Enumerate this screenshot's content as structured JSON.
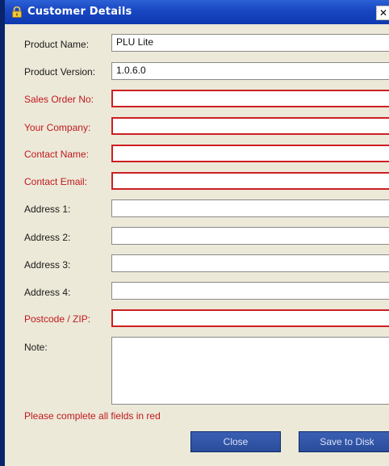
{
  "window": {
    "title": "Customer Details",
    "close_symbol": "✕"
  },
  "form": {
    "product_name": {
      "label": "Product Name:",
      "value": "PLU Lite"
    },
    "product_version": {
      "label": "Product Version:",
      "value": "1.0.6.0"
    },
    "sales_order_no": {
      "label": "Sales Order No:",
      "value": ""
    },
    "your_company": {
      "label": "Your Company:",
      "value": ""
    },
    "contact_name": {
      "label": "Contact Name:",
      "value": ""
    },
    "contact_email": {
      "label": "Contact Email:",
      "value": ""
    },
    "address1": {
      "label": "Address 1:",
      "value": ""
    },
    "address2": {
      "label": "Address 2:",
      "value": ""
    },
    "address3": {
      "label": "Address 3:",
      "value": ""
    },
    "address4": {
      "label": "Address 4:",
      "value": ""
    },
    "postcode": {
      "label": "Postcode / ZIP:",
      "value": ""
    },
    "note": {
      "label": "Note:",
      "value": ""
    }
  },
  "message": "Please complete all fields in red",
  "buttons": {
    "close": "Close",
    "save": "Save to Disk"
  },
  "colors": {
    "required": "#c01820",
    "title_bar": "#1a48c3",
    "button": "#2b4c9b"
  }
}
